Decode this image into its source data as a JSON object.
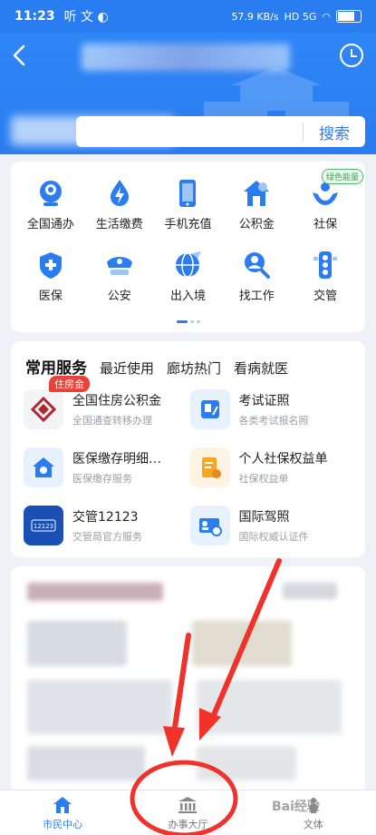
{
  "status_bar": {
    "time": "11:23",
    "left_icons": "听 文 ◐",
    "net_speed": "57.9 KB/s",
    "signal": "HD 5G"
  },
  "search": {
    "button_label": "搜索",
    "placeholder": ""
  },
  "grid": [
    {
      "label": "全国通办",
      "icon": "person-circle-icon"
    },
    {
      "label": "生活缴费",
      "icon": "bolt-drop-icon"
    },
    {
      "label": "手机充值",
      "icon": "phone-icon"
    },
    {
      "label": "公积金",
      "icon": "house-fund-icon"
    },
    {
      "label": "社保",
      "icon": "hands-person-icon",
      "tag": "绿色能量"
    },
    {
      "label": "医保",
      "icon": "medical-shield-icon"
    },
    {
      "label": "公安",
      "icon": "police-cap-icon"
    },
    {
      "label": "出入境",
      "icon": "globe-plane-icon"
    },
    {
      "label": "找工作",
      "icon": "person-search-icon"
    },
    {
      "label": "交管",
      "icon": "traffic-light-icon"
    }
  ],
  "service_tabs": [
    "常用服务",
    "最近使用",
    "廊坊热门",
    "看病就医"
  ],
  "services": [
    {
      "title": "全国住房公积金",
      "subtitle": "全国通查转移办理",
      "badge": "住房金",
      "icon": "housing-fund-logo-icon"
    },
    {
      "title": "考试证照",
      "subtitle": "各类考试报名照",
      "icon": "certificate-icon"
    },
    {
      "title": "医保缴存明细…",
      "subtitle": "医保缴存服务",
      "icon": "medical-home-icon"
    },
    {
      "title": "个人社保权益单",
      "subtitle": "社保权益单",
      "icon": "document-edit-icon"
    },
    {
      "title": "交管12123",
      "subtitle": "交管局官方服务",
      "icon": "traffic-12123-icon",
      "icon_text": "12123"
    },
    {
      "title": "国际驾照",
      "subtitle": "国际权威认证件",
      "icon": "id-card-globe-icon"
    }
  ],
  "tabbar": [
    {
      "label": "市民中心",
      "icon": "home-icon",
      "active": true
    },
    {
      "label": "办事大厅",
      "icon": "government-building-icon",
      "active": false
    },
    {
      "label": "文体",
      "icon": "sports-icon",
      "active": false
    }
  ],
  "watermark": "Bai经验",
  "colors": {
    "primary": "#2a7cf0",
    "badge_red": "#e8433a",
    "annotation_red": "#f0322a",
    "green_tag": "#3aa358"
  }
}
